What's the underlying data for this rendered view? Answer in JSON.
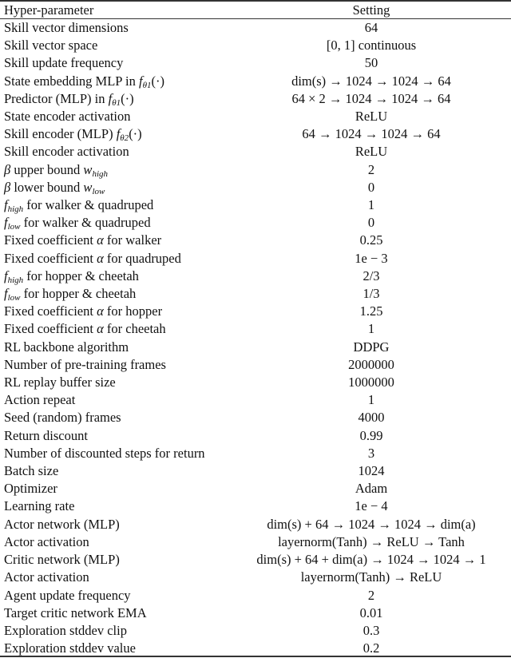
{
  "table": {
    "headers": [
      "Hyper-parameter",
      "Setting"
    ],
    "rows": [
      {
        "name": "Skill vector dimensions",
        "setting": "64"
      },
      {
        "name": "Skill vector space",
        "setting": "[0, 1] continuous"
      },
      {
        "name": "Skill update frequency",
        "setting": "50"
      },
      {
        "name": "State embedding MLP in fθ₁(·)",
        "setting": "dim(s) → 1024 → 1024 → 64"
      },
      {
        "name": "Predictor (MLP) in fθ₁(·)",
        "setting": "64 × 2 → 1024 → 1024 → 64"
      },
      {
        "name": "State encoder activation",
        "setting": "ReLU"
      },
      {
        "name": "Skill encoder (MLP) fθ₂(·)",
        "setting": "64 → 1024 → 1024 → 64"
      },
      {
        "name": "Skill encoder activation",
        "setting": "ReLU"
      },
      {
        "name": "β upper bound w_high",
        "setting": "2"
      },
      {
        "name": "β lower bound w_low",
        "setting": "0"
      },
      {
        "name": "f_high for walker & quadruped",
        "setting": "1"
      },
      {
        "name": "f_low for walker & quadruped",
        "setting": "0"
      },
      {
        "name": "Fixed coefficient α for walker",
        "setting": "0.25"
      },
      {
        "name": "Fixed coefficient α for quadruped",
        "setting": "1e − 3"
      },
      {
        "name": "f_high for hopper & cheetah",
        "setting": "2/3"
      },
      {
        "name": "f_low for hopper & cheetah",
        "setting": "1/3"
      },
      {
        "name": "Fixed coefficient α for hopper",
        "setting": "1.25"
      },
      {
        "name": "Fixed coefficient α for cheetah",
        "setting": "1"
      },
      {
        "name": "RL backbone algorithm",
        "setting": "DDPG"
      },
      {
        "name": "Number of pre-training frames",
        "setting": "2000000"
      },
      {
        "name": "RL replay buffer size",
        "setting": "1000000"
      },
      {
        "name": "Action repeat",
        "setting": "1"
      },
      {
        "name": "Seed (random) frames",
        "setting": "4000"
      },
      {
        "name": "Return discount",
        "setting": "0.99"
      },
      {
        "name": "Number of discounted steps for return",
        "setting": "3"
      },
      {
        "name": "Batch size",
        "setting": "1024"
      },
      {
        "name": "Optimizer",
        "setting": "Adam"
      },
      {
        "name": "Learning rate",
        "setting": "1e − 4"
      },
      {
        "name": "Actor network (MLP)",
        "setting": "dim(s) + 64 → 1024 → 1024 → dim(a)"
      },
      {
        "name": "Actor activation",
        "setting": "layernorm(Tanh) → ReLU → Tanh"
      },
      {
        "name": "Critic network (MLP)",
        "setting": "dim(s) + 64 + dim(a) → 1024 → 1024 → 1"
      },
      {
        "name": "Actor activation",
        "setting": "layernorm(Tanh) → ReLU"
      },
      {
        "name": "Agent update frequency",
        "setting": "2"
      },
      {
        "name": "Target critic network EMA",
        "setting": "0.01"
      },
      {
        "name": "Exploration stddev clip",
        "setting": "0.3"
      },
      {
        "name": "Exploration stddev value",
        "setting": "0.2"
      }
    ]
  }
}
